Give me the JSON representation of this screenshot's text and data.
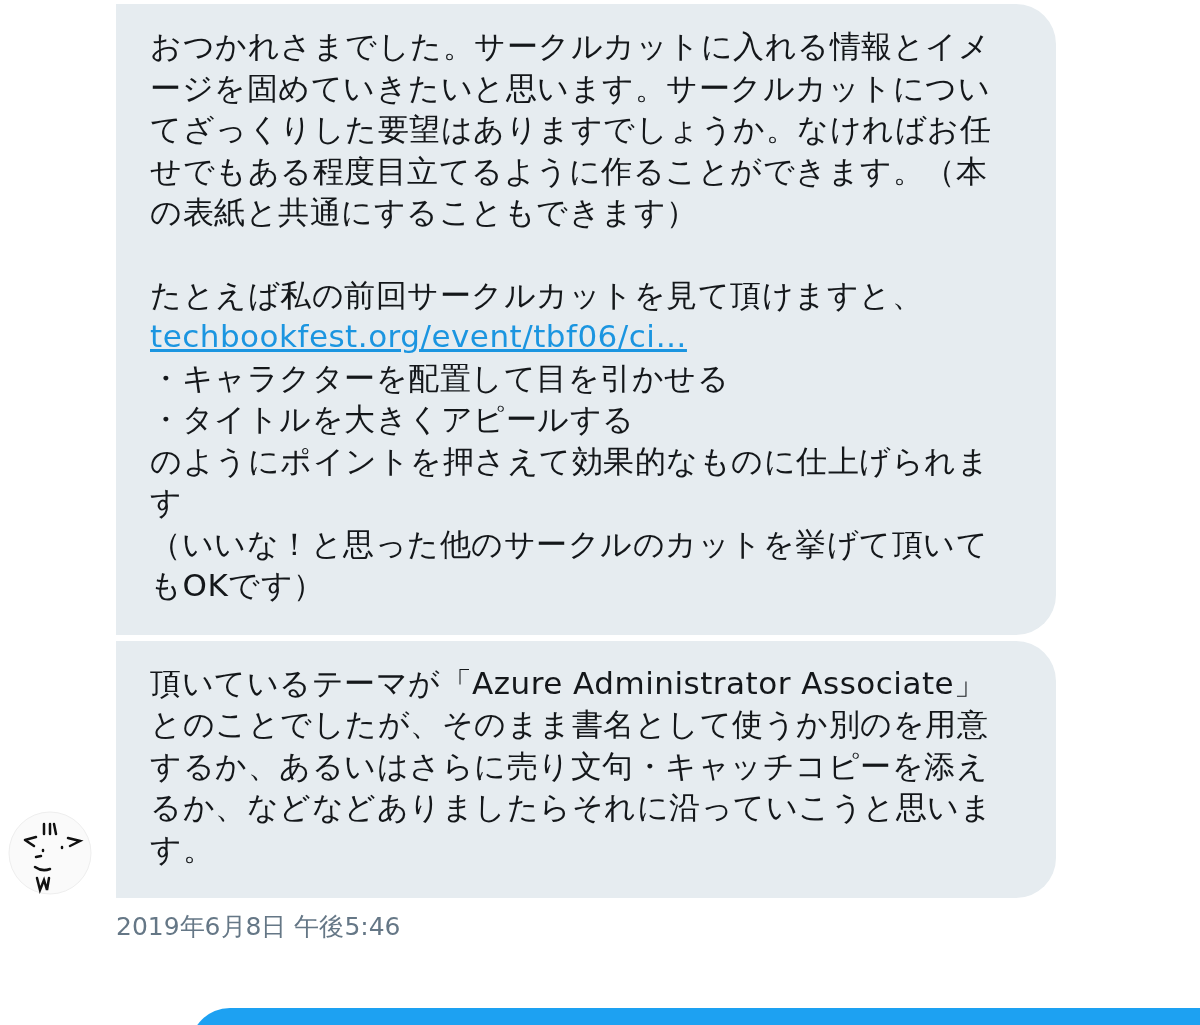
{
  "conversation": {
    "messages": [
      {
        "kind": "incoming",
        "sections": [
          [
            {
              "kind": "text",
              "text": "おつかれさまでした。サークルカットに入れる情報とイメージを固めていきたいと思います。サークルカットについてざっくりした要望はありますでしょうか。なければお任せでもある程度目立てるように作ることができます。（本の表紙と共通にすることもできます）"
            }
          ],
          [
            {
              "kind": "text",
              "text": "たとえば私の前回サークルカットを見て頂けますと、"
            },
            {
              "kind": "link",
              "text": "techbookfest.org/event/tbf06/ci…"
            },
            {
              "kind": "text",
              "text": "・キャラクターを配置して目を引かせる"
            },
            {
              "kind": "text",
              "text": "・タイトルを大きくアピールする"
            },
            {
              "kind": "text",
              "text": "のようにポイントを押さえて効果的なものに仕上げられます"
            },
            {
              "kind": "text",
              "text": "（いいな！と思った他のサークルのカットを挙げて頂いてもOKです）"
            }
          ]
        ]
      },
      {
        "kind": "incoming",
        "sections": [
          [
            {
              "kind": "text",
              "text": "頂いているテーマが「Azure Administrator Associate」とのことでしたが、そのまま書名として使うか別のを用意するか、あるいはさらに売り文句・キャッチコピーを添えるか、などなどありましたらそれに沿っていこうと思います。"
            }
          ]
        ]
      }
    ],
    "timestamp": "2019年6月8日 午後5:46",
    "next_message": {
      "kind": "outgoing"
    }
  }
}
